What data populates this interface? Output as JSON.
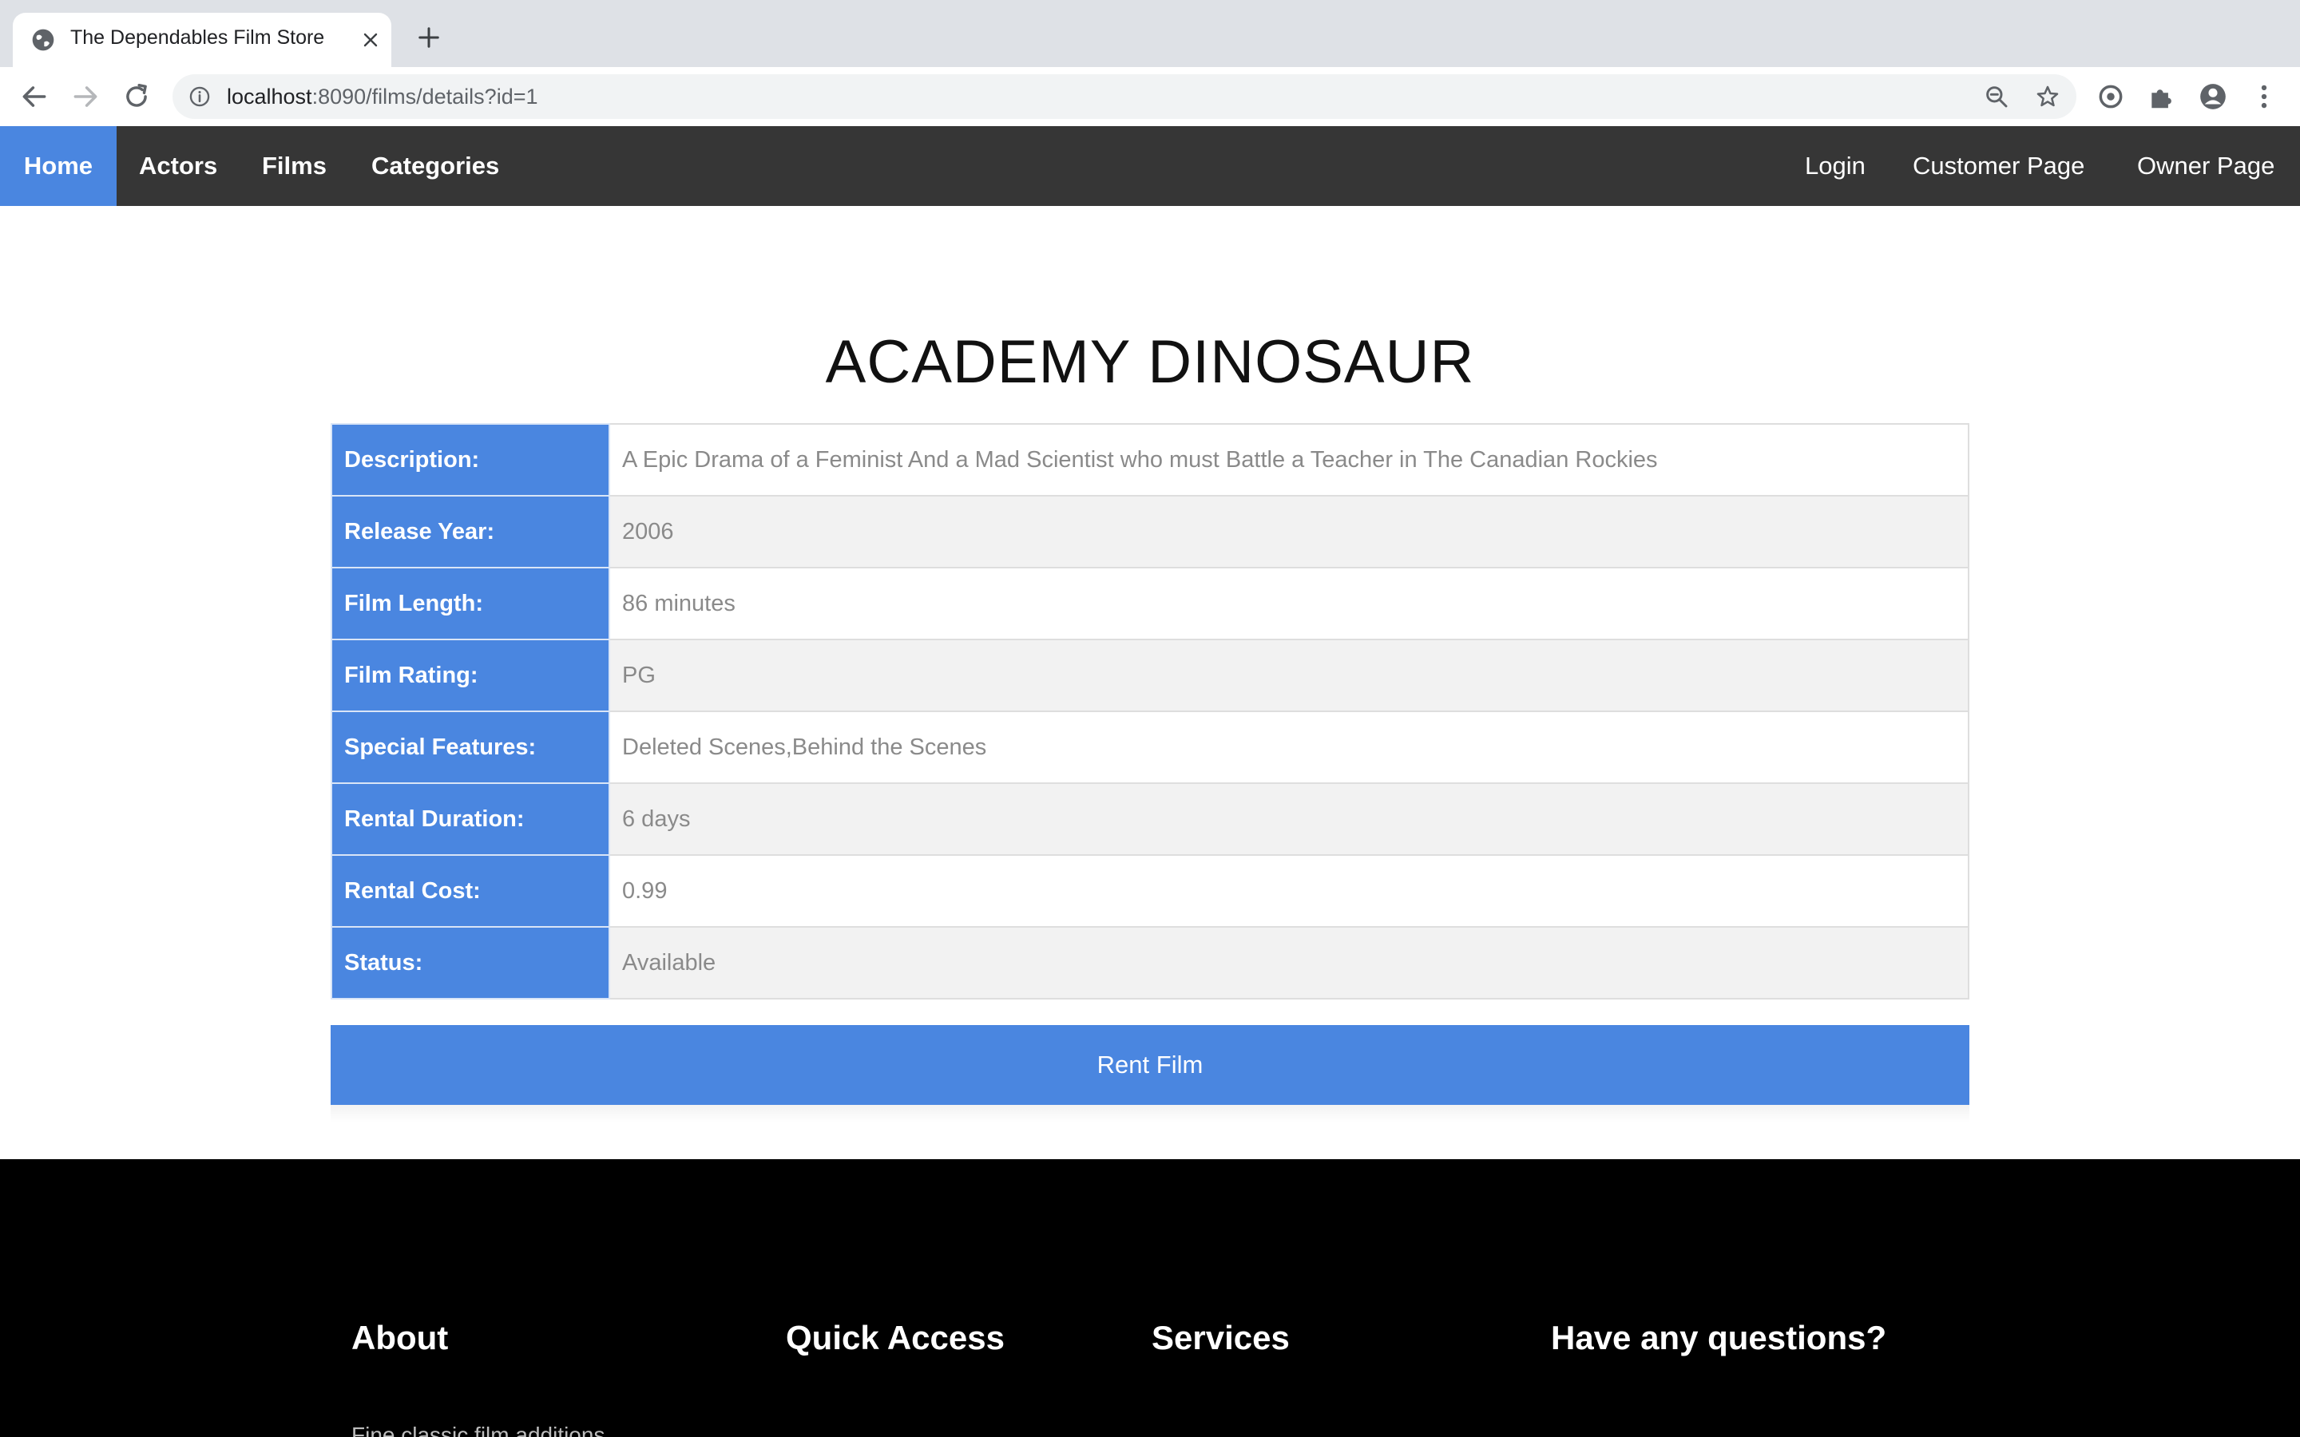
{
  "browser": {
    "tab_title": "The Dependables Film Store",
    "url_host": "localhost",
    "url_path": ":8090/films/details?id=1"
  },
  "nav": {
    "left": [
      "Home",
      "Actors",
      "Films",
      "Categories"
    ],
    "active": "Home",
    "right": [
      "Login",
      "Customer Page",
      "Owner Page"
    ]
  },
  "film": {
    "title": "ACADEMY DINOSAUR",
    "details": [
      {
        "label": "Description:",
        "value": "A Epic Drama of a Feminist And a Mad Scientist who must Battle a Teacher in The Canadian Rockies"
      },
      {
        "label": "Release Year:",
        "value": "2006"
      },
      {
        "label": "Film Length:",
        "value": "86 minutes"
      },
      {
        "label": "Film Rating:",
        "value": "PG"
      },
      {
        "label": "Special Features:",
        "value": "Deleted Scenes,Behind the Scenes"
      },
      {
        "label": "Rental Duration:",
        "value": "6 days"
      },
      {
        "label": "Rental Cost:",
        "value": "0.99"
      },
      {
        "label": "Status:",
        "value": "Available"
      }
    ],
    "rent_button": "Rent Film"
  },
  "footer": {
    "headings": [
      "About",
      "Quick Access",
      "Services",
      "Have any questions?"
    ],
    "about_text": "Fine classic film additions"
  },
  "colors": {
    "accent": "#4a86e0",
    "navbar": "#363636",
    "footer": "#000000"
  }
}
